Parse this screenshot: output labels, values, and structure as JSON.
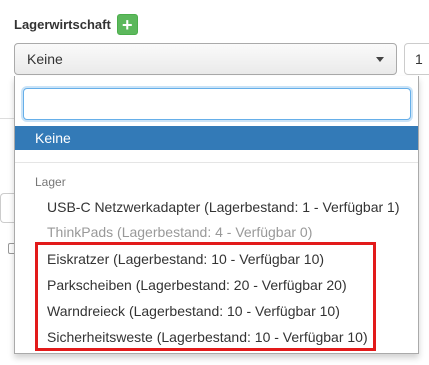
{
  "field": {
    "label": "Lagerwirtschaft",
    "add_icon": "plus-icon",
    "add_symbol": "+"
  },
  "select": {
    "value": "Keine",
    "caret_icon": "caret-down-icon"
  },
  "quantity": {
    "value": "1"
  },
  "dropdown": {
    "search_value": "",
    "selected_option": "Keine",
    "group_label": "Lager",
    "options": [
      {
        "label": "USB-C Netzwerkadapter (Lagerbestand: 1 - Verfügbar 1)",
        "disabled": false
      },
      {
        "label": "ThinkPads (Lagerbestand: 4 - Verfügbar 0)",
        "disabled": true
      },
      {
        "label": "Eiskratzer (Lagerbestand: 10 - Verfügbar 10)",
        "disabled": false
      },
      {
        "label": "Parkscheiben (Lagerbestand: 20 - Verfügbar 20)",
        "disabled": false
      },
      {
        "label": "Warndreieck (Lagerbestand: 10 - Verfügbar 10)",
        "disabled": false
      },
      {
        "label": "Sicherheitsweste (Lagerbestand: 10 - Verfügbar 10)",
        "disabled": false
      }
    ]
  },
  "colors": {
    "accent": "#337ab7",
    "add_button": "#5cb85c",
    "annotation": "#e21a1a"
  }
}
